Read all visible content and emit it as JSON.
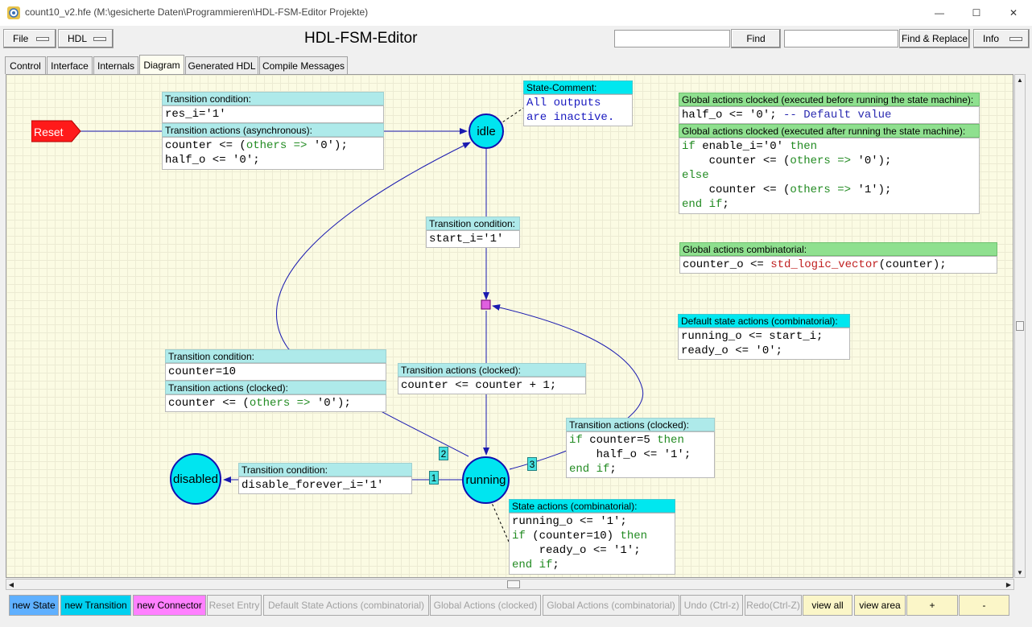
{
  "window": {
    "title": "count10_v2.hfe (M:\\gesicherte Daten\\Programmieren\\HDL-FSM-Editor Projekte)",
    "minimize": "—",
    "maximize": "☐",
    "close": "✕"
  },
  "toolbar": {
    "file_label": "File",
    "hdl_label": "HDL",
    "app_title": "HDL-FSM-Editor",
    "find_value": "",
    "find_label": "Find",
    "replace_value": "",
    "find_replace_label": "Find & Replace",
    "info_label": "Info"
  },
  "tabs": [
    {
      "label": "Control"
    },
    {
      "label": "Interface"
    },
    {
      "label": "Internals"
    },
    {
      "label": "Diagram",
      "active": true
    },
    {
      "label": "Generated HDL"
    },
    {
      "label": "Compile Messages"
    }
  ],
  "diagram": {
    "reset_label": "Reset",
    "states": {
      "idle": "idle",
      "running": "running",
      "disabled": "disabled"
    },
    "reset_transition": {
      "cond_header": "Transition condition:",
      "cond": "res_i='1'",
      "act_header": "Transition actions (asynchronous):",
      "act1_sig": "counter <= (",
      "act1_kw": "others =>",
      "act1_rest": " '0');",
      "act2": "half_o <= '0';"
    },
    "state_comment": {
      "header": "State-Comment:",
      "line1": "All outputs",
      "line2": "are inactive."
    },
    "idle_to_running": {
      "cond_header": "Transition condition:",
      "cond": "start_i='1'",
      "act_header": "Transition actions (clocked):",
      "act": "counter <= counter + 1;"
    },
    "running_to_idle": {
      "cond_header": "Transition condition:",
      "cond": "counter=10",
      "act_header": "Transition actions (clocked):",
      "act_sig": "counter <= (",
      "act_kw": "others =>",
      "act_rest": " '0');",
      "priority": "2"
    },
    "running_to_disabled": {
      "cond_header": "Transition condition:",
      "cond": "disable_forever_i='1'",
      "priority": "1"
    },
    "running_loop": {
      "act_header": "Transition actions (clocked):",
      "l1a": "if",
      "l1b": " counter=5 ",
      "l1c": "then",
      "l2": "    half_o <= '1';",
      "l3a": "end if",
      "l3b": ";",
      "priority": "3"
    },
    "state_actions": {
      "header": "State actions (combinatorial):",
      "l1": "running_o <= '1';",
      "l2a": "if",
      "l2b": " (counter=10) ",
      "l2c": "then",
      "l3": "    ready_o <= '1';",
      "l4a": "end if",
      "l4b": ";"
    },
    "global_clocked": {
      "before_header": "Global actions clocked (executed before running the state machine):",
      "before_code": "half_o <= '0';",
      "before_comment": " -- Default value",
      "after_header": "Global actions clocked (executed after running the state machine):",
      "l1a": "if",
      "l1b": " enable_i='0' ",
      "l1c": "then",
      "l2a": "    counter <= (",
      "l2b": "others =>",
      "l2c": " '0');",
      "l3": "else",
      "l4a": "    counter <= (",
      "l4b": "others =>",
      "l4c": " '1');",
      "l5a": "end if",
      "l5b": ";"
    },
    "global_comb": {
      "header": "Global actions combinatorial:",
      "a": "counter_o <= ",
      "b": "std_logic_vector",
      "c": "(counter);"
    },
    "default_state": {
      "header": "Default state actions (combinatorial):",
      "l1": "running_o <= start_i;",
      "l2": "ready_o <= '0';"
    }
  },
  "bottom_toolbar": [
    {
      "label": "new State",
      "color": "#5fb0ff"
    },
    {
      "label": "new Transition",
      "color": "#00d0f0"
    },
    {
      "label": "new Connector",
      "color": "#ff80ff"
    },
    {
      "label": "Reset Entry"
    },
    {
      "label": "Default State Actions (combinatorial)"
    },
    {
      "label": "Global Actions (clocked)"
    },
    {
      "label": "Global Actions (combinatorial)"
    },
    {
      "label": "Undo (Ctrl-z)"
    },
    {
      "label": "Redo(Ctrl-Z)"
    },
    {
      "label": "view all"
    },
    {
      "label": "view area"
    },
    {
      "label": "+"
    },
    {
      "label": "-"
    }
  ],
  "colors": {
    "state_fill": "#00e5f0",
    "state_border": "#1010b0",
    "canvas_bg": "#fbfbe3",
    "connector": "#e060e0",
    "reset": "#ff1a1a"
  }
}
